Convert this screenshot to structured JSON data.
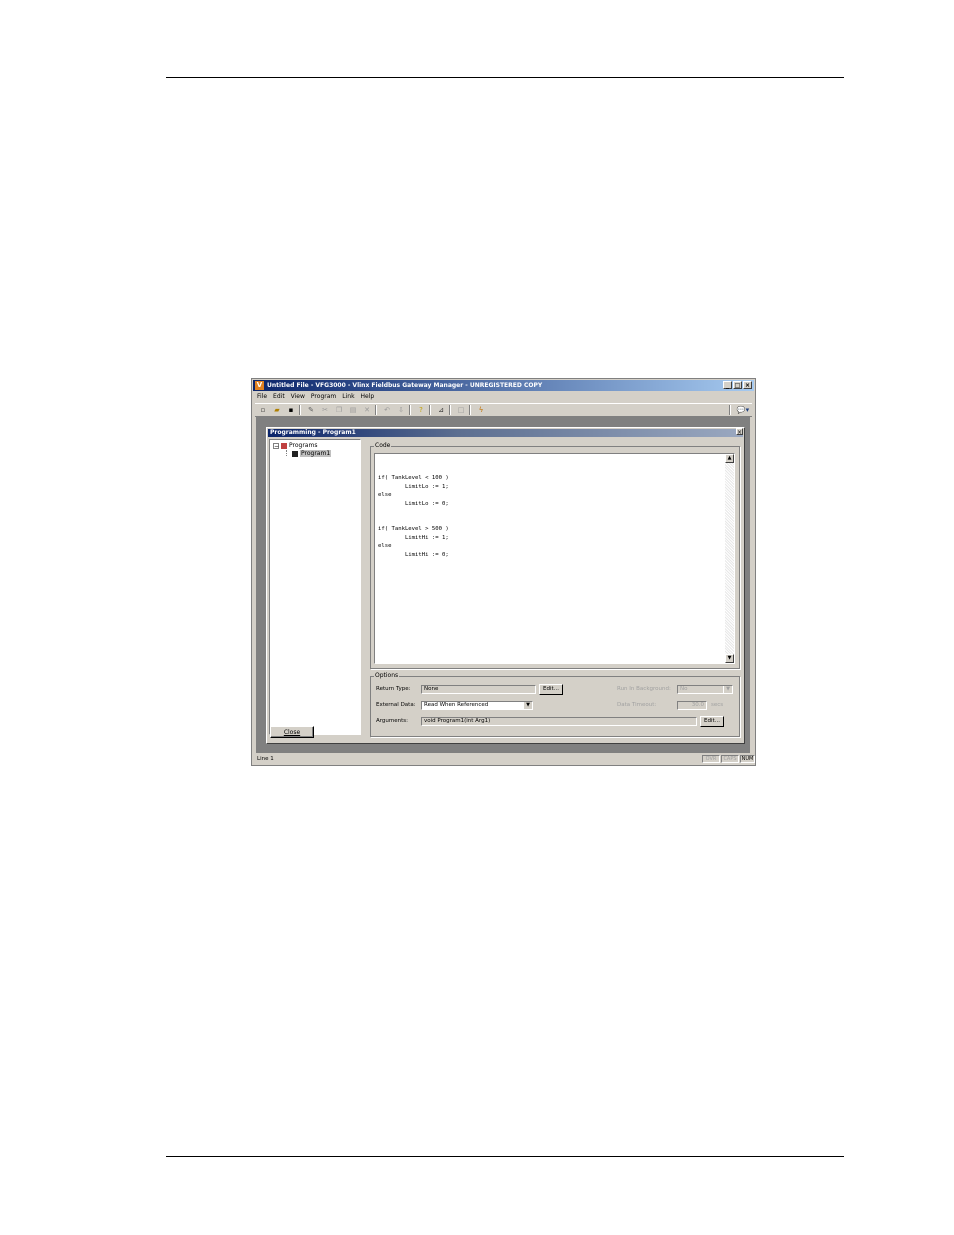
{
  "window": {
    "title": "Untitled File - VFG3000 - Vlinx Fieldbus Gateway Manager - UNREGISTERED COPY",
    "app_icon": "V",
    "minimize": "_",
    "maximize": "□",
    "close": "×"
  },
  "menu": [
    "File",
    "Edit",
    "View",
    "Program",
    "Link",
    "Help"
  ],
  "toolbar": {
    "icons": [
      "new-icon",
      "open-icon",
      "save-icon",
      "pencil-icon",
      "cut-icon",
      "copy-icon",
      "paste-icon",
      "delete-icon",
      "undo-icon",
      "redo-icon",
      "help-icon",
      "find-icon",
      "frame-icon",
      "lightning-icon",
      "comment-icon"
    ]
  },
  "child": {
    "title": "Programming - Program1",
    "close": "×"
  },
  "tree": {
    "root_label": "Programs",
    "expand_symbol": "−",
    "item_label": "Program1"
  },
  "close_button": "Close",
  "code_group": {
    "label": "Code",
    "text": "if( TankLevel < 100 )\n        LimitLo := 1;\nelse\n        LimitLo := 0;\n\n\nif( TankLevel > 500 )\n        LimitHi := 1;\nelse\n        LimitHi := 0;"
  },
  "options": {
    "label": "Options",
    "return_type_label": "Return Type:",
    "return_type_value": "None",
    "return_edit": "Edit...",
    "external_data_label": "External Data:",
    "external_data_value": "Read When Referenced",
    "arguments_label": "Arguments:",
    "arguments_value": "void Program1(int Arg1)",
    "arguments_edit": "Edit...",
    "background_label": "Run In Background:",
    "background_value": "No",
    "timeout_label": "Data Timeout:",
    "timeout_value": "30.0",
    "timeout_unit": "secs"
  },
  "status": {
    "text": "Line 1",
    "ovr": "OVR",
    "caps": "CAPS",
    "num": "NUM"
  }
}
